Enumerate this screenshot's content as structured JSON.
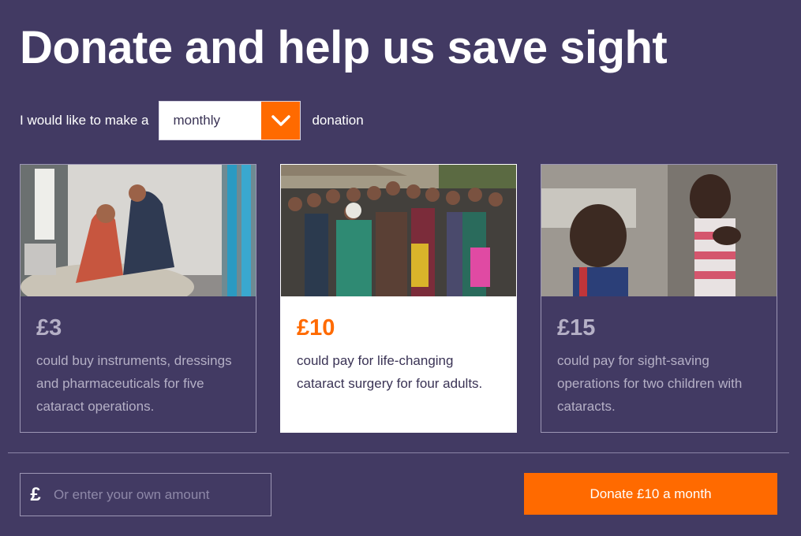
{
  "header": {
    "title": "Donate and help us save sight"
  },
  "frequency": {
    "prefix": "I would like to make a",
    "selected": "monthly",
    "suffix": "donation"
  },
  "options": [
    {
      "amount": "£3",
      "description": "could buy instruments, dressings and pharmaceuticals for five cataract operations.",
      "selected": false
    },
    {
      "amount": "£10",
      "description": "could pay for life-changing cataract surgery for four adults.",
      "selected": true
    },
    {
      "amount": "£15",
      "description": "could pay for sight-saving operations for two children with cataracts.",
      "selected": false
    }
  ],
  "custom_amount": {
    "currency_symbol": "£",
    "placeholder": "Or enter your own amount",
    "value": ""
  },
  "donate_button": {
    "label": "Donate £10 a month"
  },
  "colors": {
    "background": "#423a63",
    "accent": "#ff6a00",
    "card_border": "#9c96b4",
    "selected_card": "#ffffff"
  },
  "icons": {
    "dropdown": "chevron-down-icon"
  }
}
